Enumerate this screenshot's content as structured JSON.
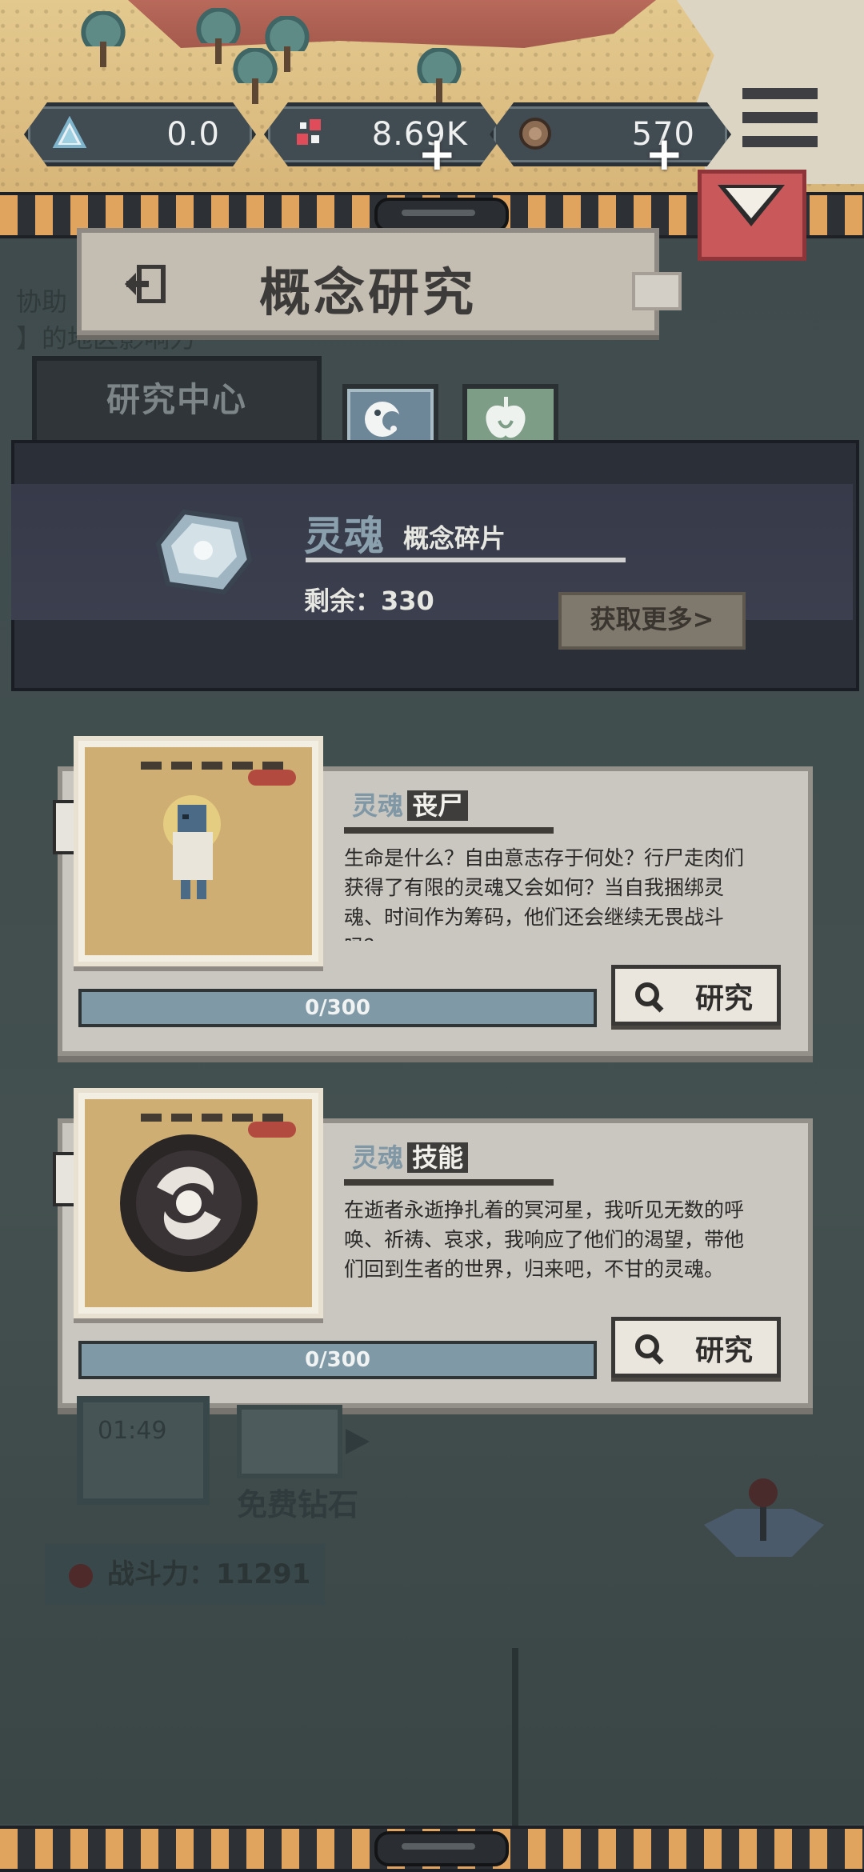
{
  "resources": {
    "crystal": "0.0",
    "gems": "8.69K",
    "coins": "570"
  },
  "page_title": "概念研究",
  "research_center_tab": "研究中心",
  "background_text": {
    "line1": "协助",
    "line2": "】的地区影响力",
    "free_gem": "免费钻石",
    "timer": "01:49",
    "power": "战斗力：11291"
  },
  "fragment": {
    "name": "灵魂",
    "type": "概念碎片",
    "remaining": "剩余：330",
    "get_more": "获取更多>"
  },
  "cards": [
    {
      "category": "灵魂",
      "name": "丧尸",
      "description": "生命是什么？自由意志存于何处？行尸走肉们获得了有限的灵魂又会如何？当自我捆绑灵魂、时间作为筹码，他们还会继续无畏战斗吗？",
      "progress_text": "0/300",
      "progress": 0,
      "button": "研究"
    },
    {
      "category": "灵魂",
      "name": "技能",
      "description": "在逝者永逝挣扎着的冥河星，我听见无数的呼唤、祈祷、哀求，我响应了他们的渴望，带他们回到生者的世界，归来吧，不甘的灵魂。",
      "progress_text": "0/300",
      "progress": 0,
      "button": "研究"
    }
  ],
  "colors": {
    "hazard_orange": "#e0a45e",
    "collapse_red": "#c9585b",
    "soul_blue": "#8aa0ad",
    "progress_fill": "#7f9aa6"
  }
}
